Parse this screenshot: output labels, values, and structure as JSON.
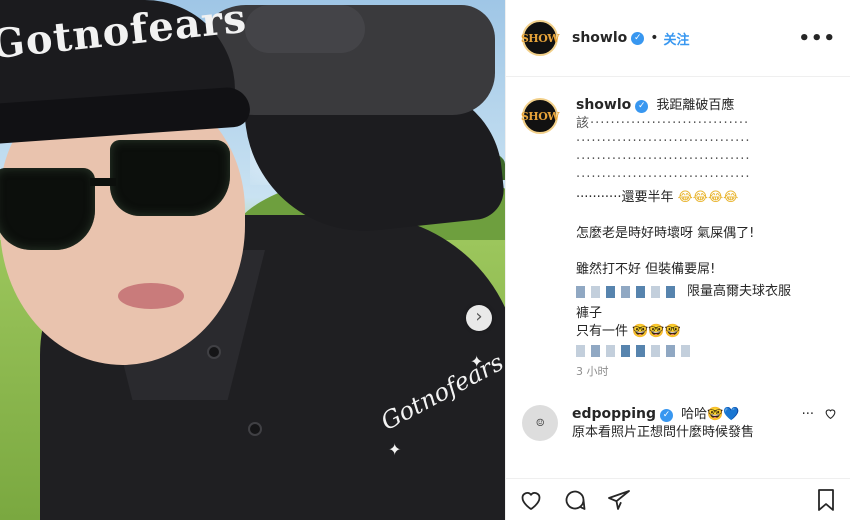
{
  "post": {
    "photo": {
      "cap_logo": "Gotnofears",
      "shirt_logo": "Gotnofears",
      "next_icon": "chevron-right-icon"
    },
    "header": {
      "username": "showlo",
      "avatar_text": "SHOW",
      "separator": "•",
      "follow_label": "关注",
      "more_label": "•••"
    },
    "caption": {
      "username": "showlo",
      "line1": "我距離破百應",
      "line2": "該·······························",
      "dots": "··································",
      "line_half_year": "···········還要半年",
      "half_year_emoji": "😂😂😂😂",
      "line_why": "怎麼老是時好時壞呀 氣屎偶了!",
      "line_gear": "雖然打不好 但裝備要屌!",
      "line_limited": "限量高爾夫球衣服",
      "line_pants": "褲子",
      "line_only_one": "只有一件",
      "only_one_emoji": "🤓🤓🤓",
      "time": "3 小时"
    },
    "reply": {
      "username": "edpopping",
      "text1": "哈哈",
      "text1_emoji": "🤓💙",
      "text2": "原本看照片正想問什麼時候發售",
      "more_label": "···"
    },
    "actions": {
      "like_icon": "heart-icon",
      "comment_icon": "comment-icon",
      "share_icon": "share-icon",
      "save_icon": "bookmark-icon"
    },
    "colors": {
      "accent": "#3897f0",
      "text": "#262626",
      "muted": "#8e8e8e"
    }
  }
}
